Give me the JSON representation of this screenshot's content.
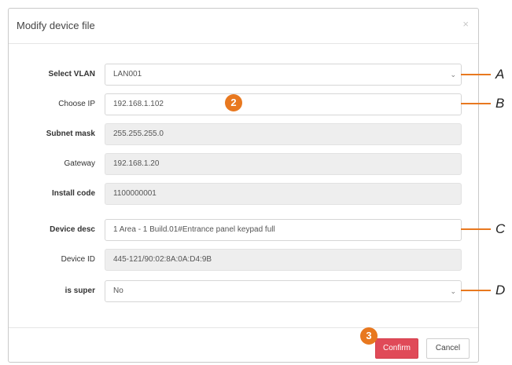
{
  "dialog": {
    "title": "Modify device file",
    "close_symbol": "×"
  },
  "form": {
    "vlan": {
      "label": "Select VLAN",
      "value": "LAN001",
      "caret": "⌄"
    },
    "ip": {
      "label": "Choose IP",
      "value": "192.168.1.102"
    },
    "subnet": {
      "label": "Subnet mask",
      "value": "255.255.255.0"
    },
    "gateway": {
      "label": "Gateway",
      "value": "192.168.1.20"
    },
    "install_code": {
      "label": "Install code",
      "value": "1100000001"
    },
    "device_desc": {
      "label": "Device desc",
      "value": "1 Area - 1 Build.01#Entrance panel keypad full"
    },
    "device_id": {
      "label": "Device ID",
      "value": "445-121/90:02:8A:0A:D4:9B"
    },
    "is_super": {
      "label": "is super",
      "value": "No",
      "caret": "⌄"
    }
  },
  "footer": {
    "confirm_label": "Confirm",
    "cancel_label": "Cancel"
  },
  "annotations": {
    "letters": [
      "A",
      "B",
      "C",
      "D"
    ],
    "badges": [
      "2",
      "3"
    ]
  },
  "colors": {
    "accent_orange": "#e8781f",
    "confirm_red": "#e04a58",
    "readonly_bg": "#eeeeee"
  },
  "icons": {
    "close": "close-icon",
    "dropdown": "chevron-down-icon"
  }
}
